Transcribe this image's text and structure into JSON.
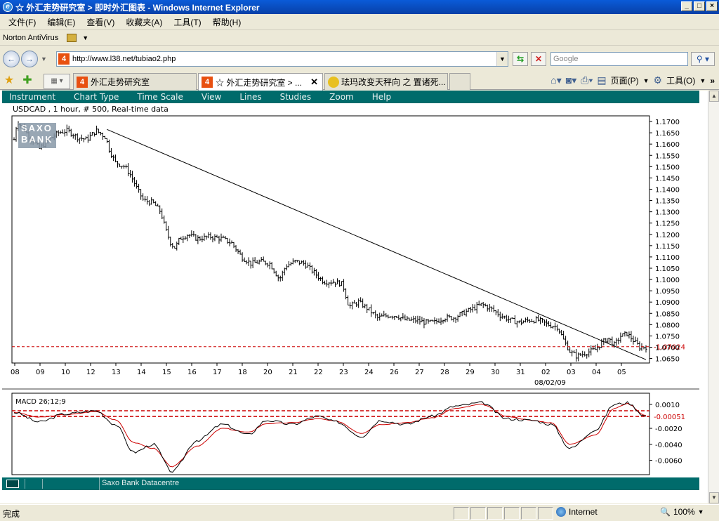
{
  "window": {
    "title": "☆ 外汇走势研究室 > 即时外汇图表 - Windows Internet Explorer",
    "btn_min": "_",
    "btn_max": "□",
    "btn_close": "×"
  },
  "menu": [
    "文件(F)",
    "编辑(E)",
    "查看(V)",
    "收藏夹(A)",
    "工具(T)",
    "帮助(H)"
  ],
  "norton": {
    "label": "Norton AntiVirus"
  },
  "address": {
    "url": "http://www.l38.net/tubiao2.php",
    "search_placeholder": "Google"
  },
  "tabs": [
    {
      "label": "外汇走势研究室"
    },
    {
      "label": "☆ 外汇走势研究室 > ..."
    },
    {
      "label": "珐玛改变天秤向 之 置诸死..."
    }
  ],
  "commands": {
    "page": "页面(P)",
    "tools": "工具(O)"
  },
  "applet": {
    "menu": [
      "Instrument",
      "Chart Type",
      "Time Scale",
      "View",
      "Lines",
      "Studies",
      "Zoom",
      "Help"
    ],
    "chart_title": "USDCAD , 1 hour, # 500, Real-time data",
    "watermark": "SAXO BANK",
    "datacentre": "Saxo Bank Datacentre"
  },
  "status": {
    "text": "完成",
    "zone": "Internet",
    "zoom": "100%"
  },
  "colors": {
    "teal": "#006b6b",
    "ie_blue": "#0a5bd8",
    "current_price": "#cc0000",
    "signal": "#cc0000"
  },
  "chart_data": [
    {
      "type": "bar",
      "title": "USDCAD , 1 hour, # 500, Real-time data",
      "x_tick_labels": [
        "08",
        "09",
        "10",
        "12",
        "13",
        "14",
        "15",
        "16",
        "17",
        "18",
        "20",
        "21",
        "22",
        "23",
        "24",
        "26",
        "27",
        "28",
        "29",
        "30",
        "31",
        "02",
        "03",
        "04",
        "05"
      ],
      "x_date_label": "08/02/09",
      "y_tick_labels": [
        "1.1700",
        "1.1650",
        "1.1600",
        "1.1550",
        "1.1500",
        "1.1450",
        "1.1400",
        "1.1350",
        "1.1300",
        "1.1250",
        "1.1200",
        "1.1150",
        "1.1100",
        "1.1050",
        "1.1000",
        "1.0950",
        "1.0900",
        "1.0850",
        "1.0800",
        "1.0750",
        "1.0700",
        "1.0650"
      ],
      "ylim": [
        1.063,
        1.1725
      ],
      "current_price": "1.07024",
      "trendline": [
        [
          0.147,
          1.1665
        ],
        [
          1.0,
          1.0645
        ]
      ],
      "price_path": [
        [
          0.0,
          1.162
        ],
        [
          0.005,
          1.17
        ],
        [
          0.012,
          1.168
        ],
        [
          0.025,
          1.163
        ],
        [
          0.04,
          1.158
        ],
        [
          0.055,
          1.162
        ],
        [
          0.07,
          1.165
        ],
        [
          0.085,
          1.166
        ],
        [
          0.1,
          1.163
        ],
        [
          0.115,
          1.162
        ],
        [
          0.13,
          1.166
        ],
        [
          0.145,
          1.163
        ],
        [
          0.15,
          1.158
        ],
        [
          0.16,
          1.152
        ],
        [
          0.175,
          1.15
        ],
        [
          0.185,
          1.146
        ],
        [
          0.195,
          1.14
        ],
        [
          0.205,
          1.135
        ],
        [
          0.22,
          1.134
        ],
        [
          0.232,
          1.13
        ],
        [
          0.24,
          1.122
        ],
        [
          0.248,
          1.116
        ],
        [
          0.255,
          1.114
        ],
        [
          0.262,
          1.118
        ],
        [
          0.275,
          1.12
        ],
        [
          0.29,
          1.118
        ],
        [
          0.31,
          1.119
        ],
        [
          0.33,
          1.118
        ],
        [
          0.345,
          1.116
        ],
        [
          0.36,
          1.11
        ],
        [
          0.375,
          1.107
        ],
        [
          0.39,
          1.108
        ],
        [
          0.405,
          1.107
        ],
        [
          0.42,
          1.1
        ],
        [
          0.43,
          1.106
        ],
        [
          0.445,
          1.108
        ],
        [
          0.46,
          1.107
        ],
        [
          0.475,
          1.103
        ],
        [
          0.49,
          1.099
        ],
        [
          0.505,
          1.099
        ],
        [
          0.52,
          1.098
        ],
        [
          0.53,
          1.088
        ],
        [
          0.545,
          1.09
        ],
        [
          0.56,
          1.087
        ],
        [
          0.575,
          1.083
        ],
        [
          0.59,
          1.084
        ],
        [
          0.605,
          1.084
        ],
        [
          0.62,
          1.082
        ],
        [
          0.635,
          1.082
        ],
        [
          0.65,
          1.081
        ],
        [
          0.665,
          1.081
        ],
        [
          0.68,
          1.083
        ],
        [
          0.695,
          1.083
        ],
        [
          0.71,
          1.085
        ],
        [
          0.725,
          1.087
        ],
        [
          0.74,
          1.089
        ],
        [
          0.755,
          1.087
        ],
        [
          0.77,
          1.084
        ],
        [
          0.785,
          1.082
        ],
        [
          0.8,
          1.081
        ],
        [
          0.815,
          1.082
        ],
        [
          0.83,
          1.082
        ],
        [
          0.845,
          1.08
        ],
        [
          0.86,
          1.079
        ],
        [
          0.87,
          1.073
        ],
        [
          0.88,
          1.068
        ],
        [
          0.89,
          1.066
        ],
        [
          0.9,
          1.067
        ],
        [
          0.91,
          1.068
        ],
        [
          0.92,
          1.069
        ],
        [
          0.93,
          1.072
        ],
        [
          0.94,
          1.074
        ],
        [
          0.95,
          1.071
        ],
        [
          0.96,
          1.075
        ],
        [
          0.97,
          1.076
        ],
        [
          0.98,
          1.073
        ],
        [
          0.99,
          1.07
        ],
        [
          1.0,
          1.0702
        ]
      ]
    },
    {
      "type": "line",
      "title": "MACD 26;12;9",
      "y_tick_labels": [
        "0.0010",
        "-0.0020",
        "-0.0040",
        "-0.0060"
      ],
      "current_value": "-0.00051",
      "ylim": [
        -0.0078,
        0.0024
      ],
      "series": [
        {
          "values": [
            [
              0,
              0.0
            ],
            [
              0.04,
              -0.0012
            ],
            [
              0.08,
              -0.0002
            ],
            [
              0.13,
              0.0002
            ],
            [
              0.16,
              -0.0015
            ],
            [
              0.19,
              -0.005
            ],
            [
              0.22,
              -0.004
            ],
            [
              0.25,
              -0.0074
            ],
            [
              0.29,
              -0.0035
            ],
            [
              0.33,
              -0.0015
            ],
            [
              0.37,
              -0.0028
            ],
            [
              0.4,
              -0.001
            ],
            [
              0.44,
              -0.0015
            ],
            [
              0.48,
              -0.0005
            ],
            [
              0.51,
              -0.0012
            ],
            [
              0.55,
              -0.003
            ],
            [
              0.58,
              -0.001
            ],
            [
              0.62,
              -0.0015
            ],
            [
              0.66,
              -0.0005
            ],
            [
              0.7,
              0.0008
            ],
            [
              0.74,
              0.0012
            ],
            [
              0.78,
              -0.0008
            ],
            [
              0.82,
              -0.001
            ],
            [
              0.85,
              -0.0015
            ],
            [
              0.88,
              -0.0045
            ],
            [
              0.92,
              -0.0022
            ],
            [
              0.95,
              0.001
            ],
            [
              0.97,
              0.0012
            ],
            [
              1.0,
              -0.0005
            ]
          ]
        },
        {
          "values": [
            [
              0,
              0.0
            ],
            [
              0.04,
              -0.0006
            ],
            [
              0.08,
              -0.0003
            ],
            [
              0.13,
              0.0001
            ],
            [
              0.16,
              -0.0009
            ],
            [
              0.19,
              -0.0038
            ],
            [
              0.22,
              -0.0045
            ],
            [
              0.25,
              -0.0068
            ],
            [
              0.29,
              -0.0042
            ],
            [
              0.33,
              -0.002
            ],
            [
              0.37,
              -0.0025
            ],
            [
              0.4,
              -0.0014
            ],
            [
              0.44,
              -0.0013
            ],
            [
              0.48,
              -0.0008
            ],
            [
              0.51,
              -0.0011
            ],
            [
              0.55,
              -0.0026
            ],
            [
              0.58,
              -0.0015
            ],
            [
              0.62,
              -0.0013
            ],
            [
              0.66,
              -0.0007
            ],
            [
              0.7,
              0.0005
            ],
            [
              0.74,
              0.001
            ],
            [
              0.78,
              -0.0005
            ],
            [
              0.82,
              -0.001
            ],
            [
              0.85,
              -0.0013
            ],
            [
              0.88,
              -0.004
            ],
            [
              0.92,
              -0.0028
            ],
            [
              0.95,
              0.0005
            ],
            [
              0.97,
              0.0011
            ],
            [
              1.0,
              -0.0004
            ]
          ]
        }
      ]
    }
  ]
}
